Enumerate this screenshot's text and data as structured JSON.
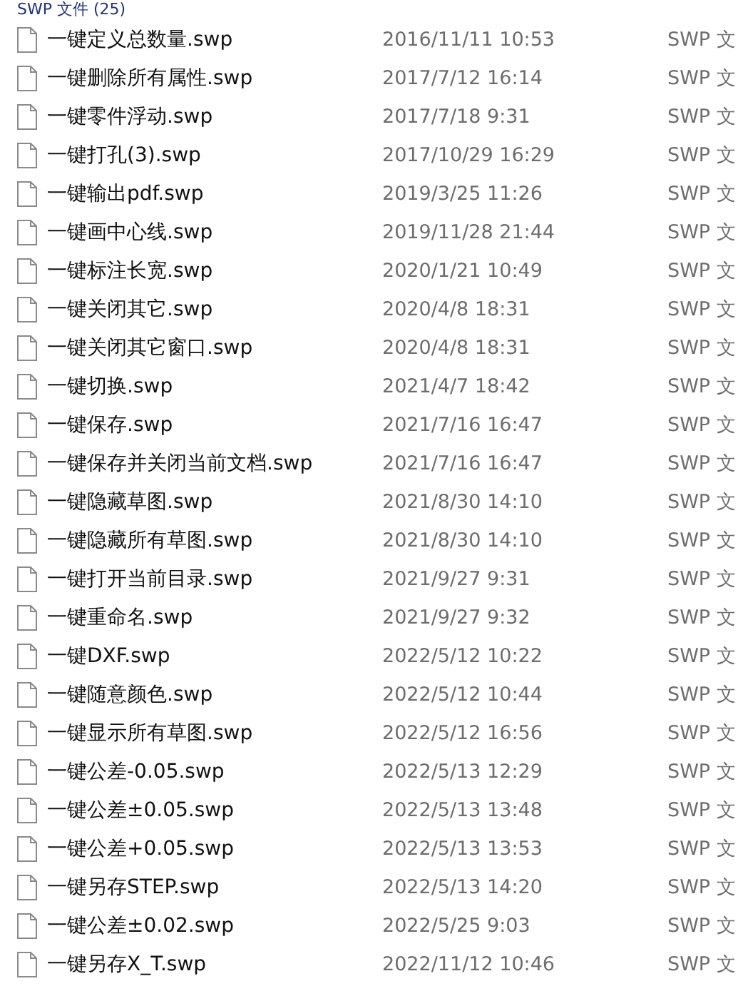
{
  "group_header": "SWP 文件 (25)",
  "files": [
    {
      "name": "一键定义总数量.swp",
      "modified": "2016/11/11 10:53",
      "type": "SWP 文"
    },
    {
      "name": "一键删除所有属性.swp",
      "modified": "2017/7/12 16:14",
      "type": "SWP 文"
    },
    {
      "name": "一键零件浮动.swp",
      "modified": "2017/7/18 9:31",
      "type": "SWP 文"
    },
    {
      "name": "一键打孔(3).swp",
      "modified": "2017/10/29 16:29",
      "type": "SWP 文"
    },
    {
      "name": "一键输出pdf.swp",
      "modified": "2019/3/25 11:26",
      "type": "SWP 文"
    },
    {
      "name": "一键画中心线.swp",
      "modified": "2019/11/28 21:44",
      "type": "SWP 文"
    },
    {
      "name": "一键标注长宽.swp",
      "modified": "2020/1/21 10:49",
      "type": "SWP 文"
    },
    {
      "name": "一键关闭其它.swp",
      "modified": "2020/4/8 18:31",
      "type": "SWP 文"
    },
    {
      "name": "一键关闭其它窗口.swp",
      "modified": "2020/4/8 18:31",
      "type": "SWP 文"
    },
    {
      "name": "一键切换.swp",
      "modified": "2021/4/7 18:42",
      "type": "SWP 文"
    },
    {
      "name": "一键保存.swp",
      "modified": "2021/7/16 16:47",
      "type": "SWP 文"
    },
    {
      "name": "一键保存并关闭当前文档.swp",
      "modified": "2021/7/16 16:47",
      "type": "SWP 文"
    },
    {
      "name": "一键隐藏草图.swp",
      "modified": "2021/8/30 14:10",
      "type": "SWP 文"
    },
    {
      "name": "一键隐藏所有草图.swp",
      "modified": "2021/8/30 14:10",
      "type": "SWP 文"
    },
    {
      "name": "一键打开当前目录.swp",
      "modified": "2021/9/27 9:31",
      "type": "SWP 文"
    },
    {
      "name": "一键重命名.swp",
      "modified": "2021/9/27 9:32",
      "type": "SWP 文"
    },
    {
      "name": "一键DXF.swp",
      "modified": "2022/5/12 10:22",
      "type": "SWP 文"
    },
    {
      "name": "一键随意颜色.swp",
      "modified": "2022/5/12 10:44",
      "type": "SWP 文"
    },
    {
      "name": "一键显示所有草图.swp",
      "modified": "2022/5/12 16:56",
      "type": "SWP 文"
    },
    {
      "name": "一键公差-0.05.swp",
      "modified": "2022/5/13 12:29",
      "type": "SWP 文"
    },
    {
      "name": "一键公差±0.05.swp",
      "modified": "2022/5/13 13:48",
      "type": "SWP 文"
    },
    {
      "name": "一键公差+0.05.swp",
      "modified": "2022/5/13 13:53",
      "type": "SWP 文"
    },
    {
      "name": "一键另存STEP.swp",
      "modified": "2022/5/13 14:20",
      "type": "SWP 文"
    },
    {
      "name": "一键公差±0.02.swp",
      "modified": "2022/5/25 9:03",
      "type": "SWP 文"
    },
    {
      "name": "一键另存X_T.swp",
      "modified": "2022/11/12 10:46",
      "type": "SWP 文"
    }
  ]
}
